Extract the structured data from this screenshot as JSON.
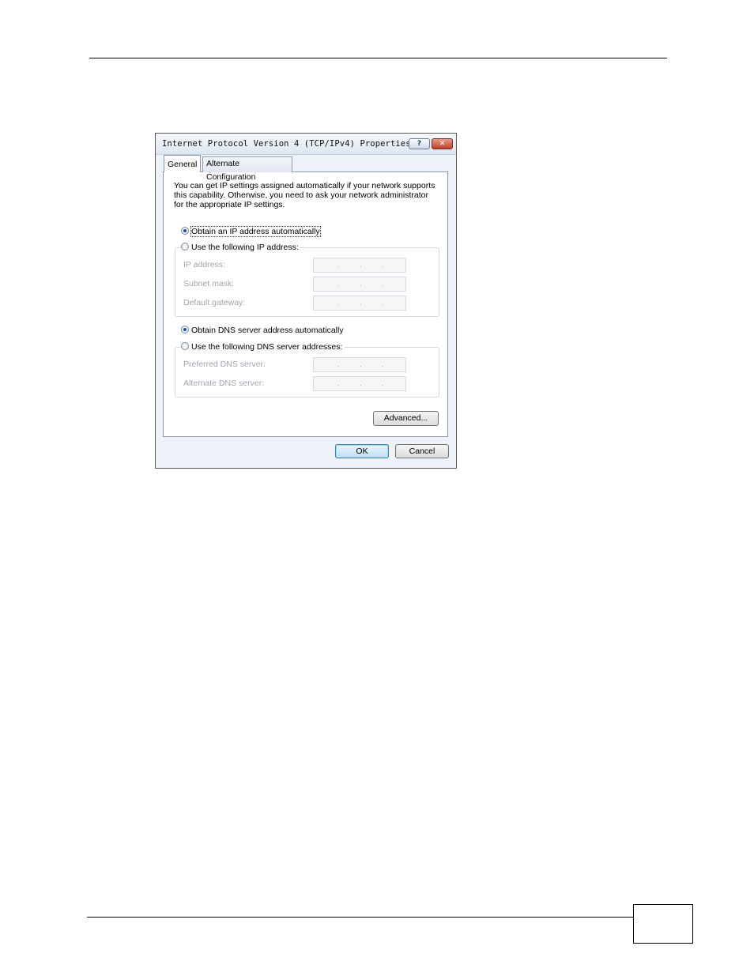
{
  "dialog": {
    "title": "Internet Protocol Version 4 (TCP/IPv4) Properties",
    "help_label": "?",
    "close_label": "✕"
  },
  "tabs": [
    {
      "label": "General",
      "selected": true
    },
    {
      "label": "Alternate Configuration",
      "selected": false
    }
  ],
  "description": [
    "You can get IP settings assigned automatically if your network supports",
    "this capability. Otherwise, you need to ask your network administrator",
    "for the appropriate IP settings."
  ],
  "ip": {
    "auto_label": "Obtain an IP address automatically",
    "manual_label": "Use the following IP address:",
    "selected": "auto",
    "fields": [
      {
        "label": "IP address:"
      },
      {
        "label": "Subnet mask:"
      },
      {
        "label": "Default gateway:"
      }
    ]
  },
  "dns": {
    "auto_label": "Obtain DNS server address automatically",
    "manual_label": "Use the following DNS server addresses:",
    "selected": "auto",
    "fields": [
      {
        "label": "Preferred DNS server:"
      },
      {
        "label": "Alternate DNS server:"
      }
    ]
  },
  "ip_separator": ".",
  "buttons": {
    "advanced": "Advanced...",
    "ok": "OK",
    "cancel": "Cancel"
  }
}
